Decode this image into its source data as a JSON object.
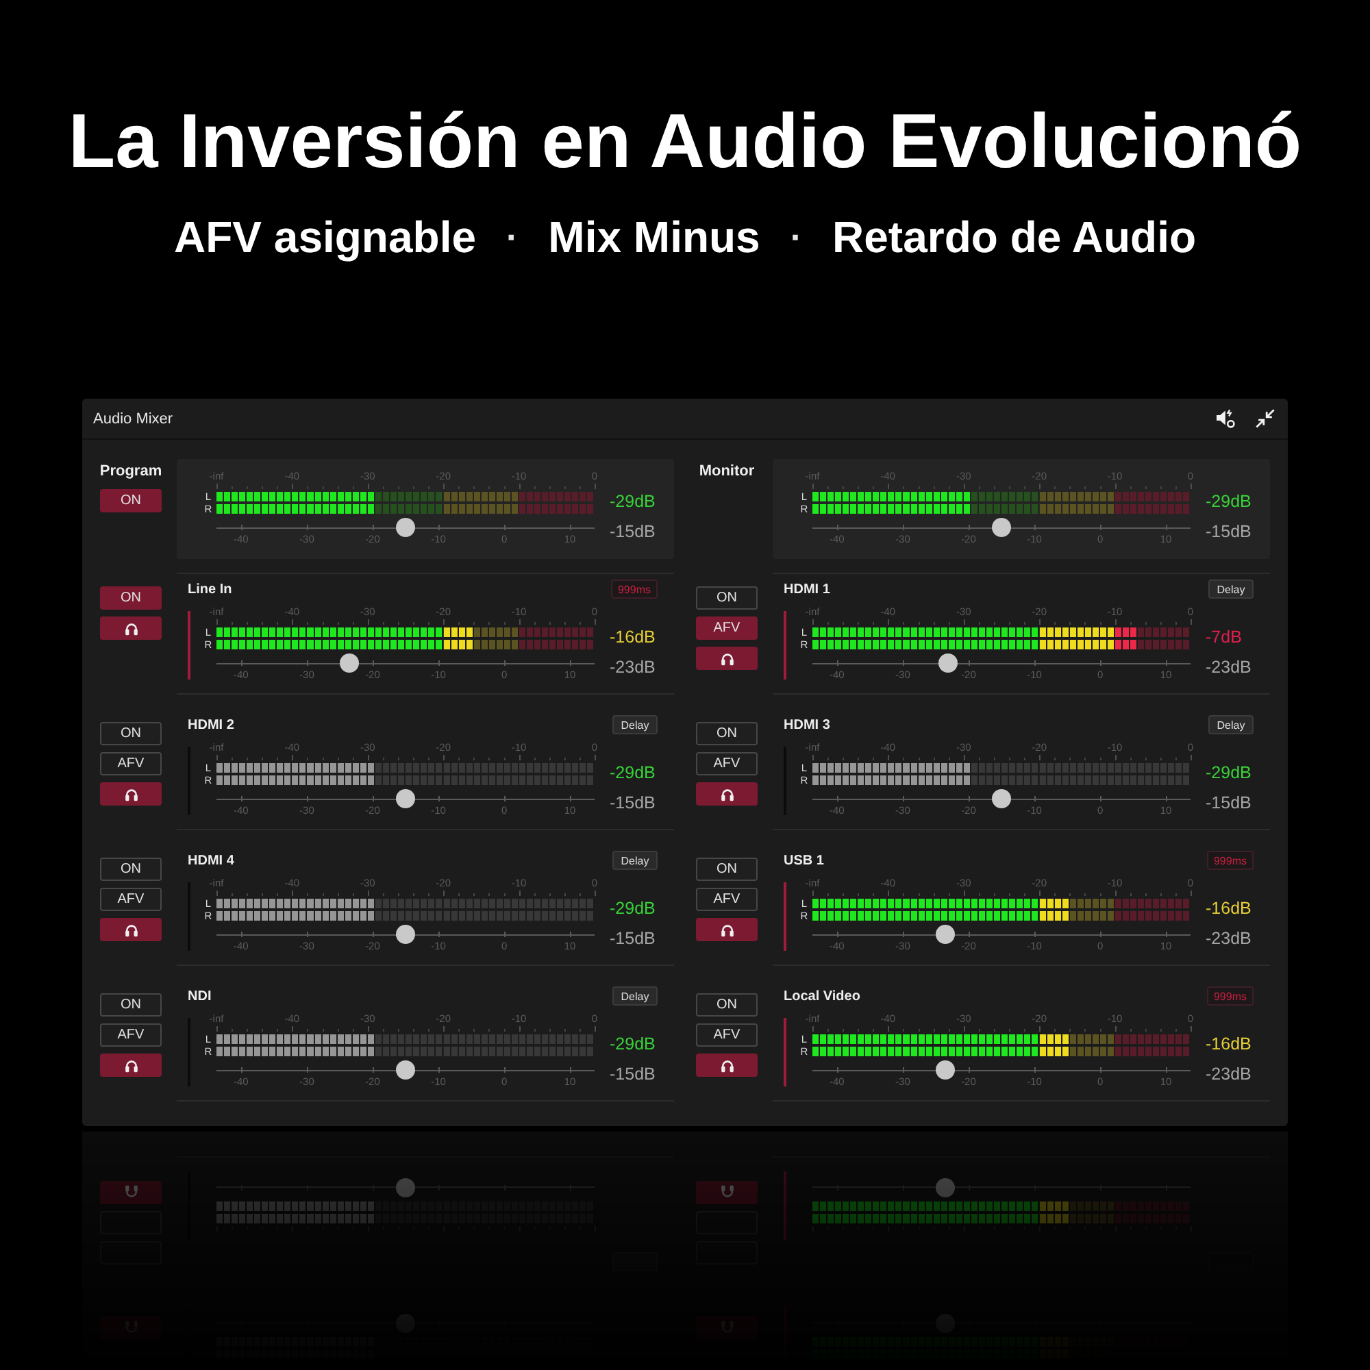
{
  "title": "La Inversión en Audio Evolucionó",
  "subtitle": [
    {
      "kind": "feature",
      "text": "AFV asignable"
    },
    {
      "kind": "separator",
      "text": "·"
    },
    {
      "kind": "feature",
      "text": "Mix Minus"
    },
    {
      "kind": "separator",
      "text": "·"
    },
    {
      "kind": "feature",
      "text": "Retardo de Audio"
    }
  ],
  "mixer": {
    "title": "Audio Mixer",
    "buses": [
      {
        "name": "Program",
        "buttons": [
          {
            "kind": "on",
            "label": "ON",
            "on": true
          }
        ],
        "scale": [
          "-inf",
          "-40",
          "-30",
          "-20",
          "-10",
          "0"
        ],
        "meter": [
          {
            "label": "L",
            "level": 0.42
          },
          {
            "label": "R",
            "level": 0.42
          }
        ],
        "fader": {
          "level": 0.5,
          "scale": [
            "-40",
            "-30",
            "-20",
            "-10",
            "0",
            "10"
          ]
        },
        "peak": "-29dB",
        "gain": "-15dB"
      },
      {
        "name": "Monitor",
        "scale": [
          "-inf",
          "-40",
          "-30",
          "-20",
          "-10",
          "0"
        ],
        "meter": [
          {
            "label": "L",
            "level": 0.42
          },
          {
            "label": "R",
            "level": 0.42
          }
        ],
        "fader": {
          "level": 0.5,
          "scale": [
            "-40",
            "-30",
            "-20",
            "-10",
            "0",
            "10"
          ]
        },
        "peak": "-29dB",
        "gain": "-15dB"
      }
    ],
    "channels": [
      {
        "name": "Line In",
        "live": true,
        "delay": {
          "text": "999ms",
          "set": true
        },
        "buttons": [
          {
            "kind": "on",
            "label": "ON",
            "on": true
          },
          {
            "kind": "monitor",
            "on": true
          }
        ],
        "scale": [
          "-inf",
          "-40",
          "-30",
          "-20",
          "-10",
          "0"
        ],
        "meter": [
          {
            "label": "L",
            "level": 0.68
          },
          {
            "label": "R",
            "level": 0.68
          }
        ],
        "fader": {
          "level": 0.35,
          "scale": [
            "-40",
            "-30",
            "-20",
            "-10",
            "0",
            "10"
          ]
        },
        "peak": "-16dB",
        "gain": "-23dB"
      },
      {
        "name": "HDMI 1",
        "live": true,
        "delay": {
          "text": "Delay",
          "set": false
        },
        "buttons": [
          {
            "kind": "on",
            "label": "ON",
            "on": false
          },
          {
            "kind": "afv",
            "label": "AFV",
            "on": true
          },
          {
            "kind": "monitor",
            "on": true
          }
        ],
        "scale": [
          "-inf",
          "-40",
          "-30",
          "-20",
          "-10",
          "0"
        ],
        "meter": [
          {
            "label": "L",
            "level": 0.86
          },
          {
            "label": "R",
            "level": 0.86
          }
        ],
        "fader": {
          "level": 0.36,
          "scale": [
            "-40",
            "-30",
            "-20",
            "-10",
            "0",
            "10"
          ]
        },
        "peak": "-7dB",
        "gain": "-23dB"
      },
      {
        "name": "HDMI 2",
        "live": false,
        "delay": {
          "text": "Delay",
          "set": false
        },
        "buttons": [
          {
            "kind": "on",
            "label": "ON",
            "on": false
          },
          {
            "kind": "afv",
            "label": "AFV",
            "on": false
          },
          {
            "kind": "monitor",
            "on": true
          }
        ],
        "scale": [
          "-inf",
          "-40",
          "-30",
          "-20",
          "-10",
          "0"
        ],
        "meter": [
          {
            "label": "L",
            "level": 0.42
          },
          {
            "label": "R",
            "level": 0.42
          }
        ],
        "fader": {
          "level": 0.5,
          "scale": [
            "-40",
            "-30",
            "-20",
            "-10",
            "0",
            "10"
          ]
        },
        "peak": "-29dB",
        "gain": "-15dB"
      },
      {
        "name": "HDMI 3",
        "live": false,
        "delay": {
          "text": "Delay",
          "set": false
        },
        "buttons": [
          {
            "kind": "on",
            "label": "ON",
            "on": false
          },
          {
            "kind": "afv",
            "label": "AFV",
            "on": false
          },
          {
            "kind": "monitor",
            "on": true
          }
        ],
        "scale": [
          "-inf",
          "-40",
          "-30",
          "-20",
          "-10",
          "0"
        ],
        "meter": [
          {
            "label": "L",
            "level": 0.42
          },
          {
            "label": "R",
            "level": 0.42
          }
        ],
        "fader": {
          "level": 0.5,
          "scale": [
            "-40",
            "-30",
            "-20",
            "-10",
            "0",
            "10"
          ]
        },
        "peak": "-29dB",
        "gain": "-15dB"
      },
      {
        "name": "HDMI 4",
        "live": false,
        "delay": {
          "text": "Delay",
          "set": false
        },
        "buttons": [
          {
            "kind": "on",
            "label": "ON",
            "on": false
          },
          {
            "kind": "afv",
            "label": "AFV",
            "on": false
          },
          {
            "kind": "monitor",
            "on": true
          }
        ],
        "scale": [
          "-inf",
          "-40",
          "-30",
          "-20",
          "-10",
          "0"
        ],
        "meter": [
          {
            "label": "L",
            "level": 0.42
          },
          {
            "label": "R",
            "level": 0.42
          }
        ],
        "fader": {
          "level": 0.5,
          "scale": [
            "-40",
            "-30",
            "-20",
            "-10",
            "0",
            "10"
          ]
        },
        "peak": "-29dB",
        "gain": "-15dB"
      },
      {
        "name": "USB 1",
        "live": true,
        "delay": {
          "text": "999ms",
          "set": true
        },
        "buttons": [
          {
            "kind": "on",
            "label": "ON",
            "on": false
          },
          {
            "kind": "afv",
            "label": "AFV",
            "on": false
          },
          {
            "kind": "monitor",
            "on": true
          }
        ],
        "scale": [
          "-inf",
          "-40",
          "-30",
          "-20",
          "-10",
          "0"
        ],
        "meter": [
          {
            "label": "L",
            "level": 0.68
          },
          {
            "label": "R",
            "level": 0.68
          }
        ],
        "fader": {
          "level": 0.35,
          "scale": [
            "-40",
            "-30",
            "-20",
            "-10",
            "0",
            "10"
          ]
        },
        "peak": "-16dB",
        "gain": "-23dB"
      },
      {
        "name": "NDI",
        "live": false,
        "delay": {
          "text": "Delay",
          "set": false
        },
        "buttons": [
          {
            "kind": "on",
            "label": "ON",
            "on": false
          },
          {
            "kind": "afv",
            "label": "AFV",
            "on": false
          },
          {
            "kind": "monitor",
            "on": true
          }
        ],
        "scale": [
          "-inf",
          "-40",
          "-30",
          "-20",
          "-10",
          "0"
        ],
        "meter": [
          {
            "label": "L",
            "level": 0.42
          },
          {
            "label": "R",
            "level": 0.42
          }
        ],
        "fader": {
          "level": 0.5,
          "scale": [
            "-40",
            "-30",
            "-20",
            "-10",
            "0",
            "10"
          ]
        },
        "peak": "-29dB",
        "gain": "-15dB"
      },
      {
        "name": "Local Video",
        "live": true,
        "delay": {
          "text": "999ms",
          "set": true
        },
        "buttons": [
          {
            "kind": "on",
            "label": "ON",
            "on": false
          },
          {
            "kind": "afv",
            "label": "AFV",
            "on": false
          },
          {
            "kind": "monitor",
            "on": true
          }
        ],
        "scale": [
          "-inf",
          "-40",
          "-30",
          "-20",
          "-10",
          "0"
        ],
        "meter": [
          {
            "label": "L",
            "level": 0.68
          },
          {
            "label": "R",
            "level": 0.68
          }
        ],
        "fader": {
          "level": 0.35,
          "scale": [
            "-40",
            "-30",
            "-20",
            "-10",
            "0",
            "10"
          ]
        },
        "peak": "-16dB",
        "gain": "-23dB"
      }
    ]
  }
}
